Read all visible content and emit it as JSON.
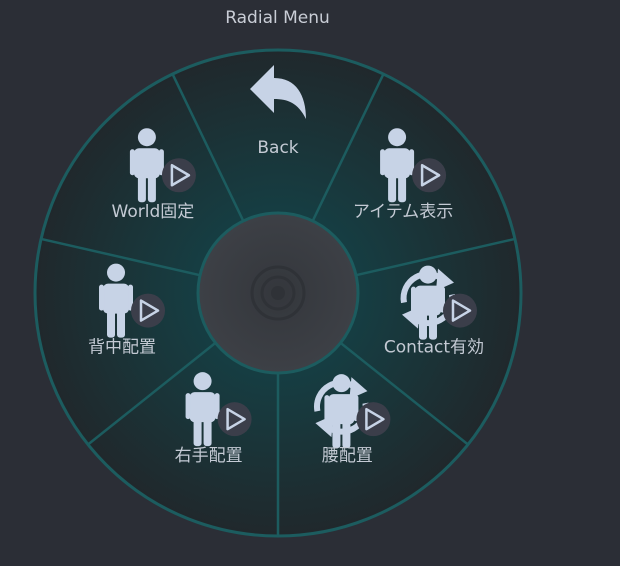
{
  "window": {
    "title": "Radial Menu"
  },
  "menu": {
    "items": [
      {
        "label": "Back",
        "icon": "back-arrow-icon",
        "type": "back"
      },
      {
        "label": "アイテム表示",
        "icon": "avatar-icon",
        "type": "submenu"
      },
      {
        "label": "Contact有効",
        "icon": "avatar-rotate-icon",
        "type": "submenu"
      },
      {
        "label": "腰配置",
        "icon": "avatar-rotate-icon",
        "type": "submenu"
      },
      {
        "label": "右手配置",
        "icon": "avatar-icon",
        "type": "submenu"
      },
      {
        "label": "背中配置",
        "icon": "avatar-icon",
        "type": "submenu"
      },
      {
        "label": "World固定",
        "icon": "avatar-icon",
        "type": "submenu"
      }
    ]
  },
  "colors": {
    "background": "#2b2e36",
    "ring_stroke": "#1c5c5f",
    "sector_fill": "#1d3034",
    "center": "#3a3d43",
    "icon": "#c7d3e6",
    "badge": "#3b3e4a",
    "text": "#c4cad4"
  }
}
